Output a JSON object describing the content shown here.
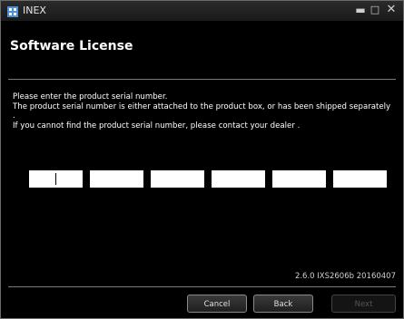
{
  "window": {
    "title": "INEX",
    "icons": {
      "app": "app-icon",
      "minimize": "minimize-icon",
      "maximize": "maximize-icon",
      "close": "close-icon"
    },
    "controls": {
      "minimize": "▬",
      "maximize": "□",
      "close": "✕"
    }
  },
  "header": {
    "title": "Software License"
  },
  "instructions": {
    "line1": "Please enter the product serial number.",
    "line2": "The product serial number is either attached to the product box, or has been shipped separately .",
    "line3": "If you cannot find the product serial number, please contact your dealer ."
  },
  "serial": {
    "fields": [
      "",
      "",
      "",
      "",
      "",
      ""
    ]
  },
  "version": "2.6.0 IXS2606b 20160407",
  "buttons": {
    "cancel": "Cancel",
    "back": "Back",
    "next": "Next"
  }
}
